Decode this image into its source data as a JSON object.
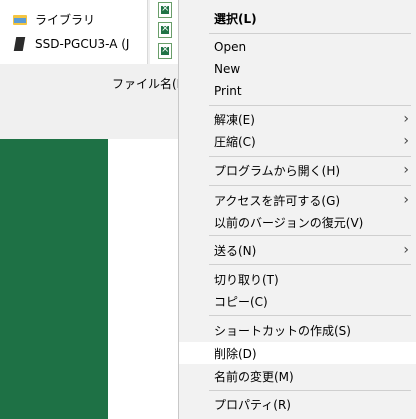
{
  "nav": {
    "items": [
      {
        "label": "ライブラリ",
        "icon": "library-folder-icon"
      },
      {
        "label": "SSD-PGCU3-A (J",
        "icon": "drive-icon"
      }
    ]
  },
  "dialog": {
    "filename_label": "ファイル名(N):"
  },
  "colors": {
    "excel_green": "#1e7145",
    "menu_bg": "#f2f2f2",
    "hover_bg": "#ffffff"
  },
  "menu": {
    "select": "選択(L)",
    "open": "Open",
    "new": "New",
    "print": "Print",
    "extract": "解凍(E)",
    "compress": "圧縮(C)",
    "open_with": "プログラムから開く(H)",
    "give_access": "アクセスを許可する(G)",
    "restore_versions": "以前のバージョンの復元(V)",
    "send_to": "送る(N)",
    "cut": "切り取り(T)",
    "copy": "コピー(C)",
    "create_shortcut": "ショートカットの作成(S)",
    "delete": "削除(D)",
    "rename": "名前の変更(M)",
    "properties": "プロパティ(R)",
    "submenu_arrow": "›"
  }
}
